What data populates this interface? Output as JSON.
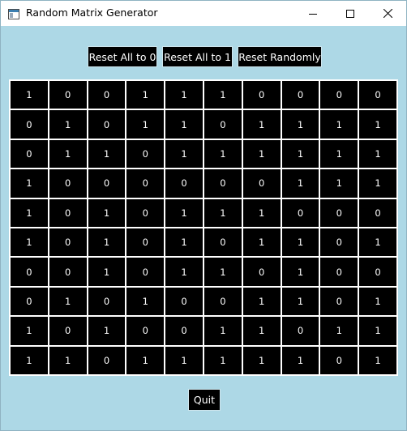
{
  "window": {
    "title": "Random Matrix Generator",
    "icon": "app-window-icon",
    "controls": [
      "minimize-icon",
      "maximize-icon",
      "close-icon"
    ]
  },
  "toolbar": {
    "reset_zero_label": "Reset All to 0",
    "reset_one_label": "Reset All to 1",
    "reset_random_label": "Reset Randomly"
  },
  "matrix": [
    [
      1,
      0,
      0,
      1,
      1,
      1,
      0,
      0,
      0,
      0
    ],
    [
      0,
      1,
      0,
      1,
      1,
      0,
      1,
      1,
      1,
      1
    ],
    [
      0,
      1,
      1,
      0,
      1,
      1,
      1,
      1,
      1,
      1
    ],
    [
      1,
      0,
      0,
      0,
      0,
      0,
      0,
      1,
      1,
      1
    ],
    [
      1,
      0,
      1,
      0,
      1,
      1,
      1,
      0,
      0,
      0
    ],
    [
      1,
      0,
      1,
      0,
      1,
      0,
      1,
      1,
      0,
      1
    ],
    [
      0,
      0,
      1,
      0,
      1,
      1,
      0,
      1,
      0,
      0
    ],
    [
      0,
      1,
      0,
      1,
      0,
      0,
      1,
      1,
      0,
      1
    ],
    [
      1,
      0,
      1,
      0,
      0,
      1,
      1,
      0,
      1,
      1
    ],
    [
      1,
      1,
      0,
      1,
      1,
      1,
      1,
      1,
      0,
      1
    ]
  ],
  "footer": {
    "quit_label": "Quit"
  },
  "colors": {
    "background": "#add8e6",
    "cell_background": "#000000",
    "cell_text": "#ffffff",
    "titlebar": "#ffffff"
  }
}
